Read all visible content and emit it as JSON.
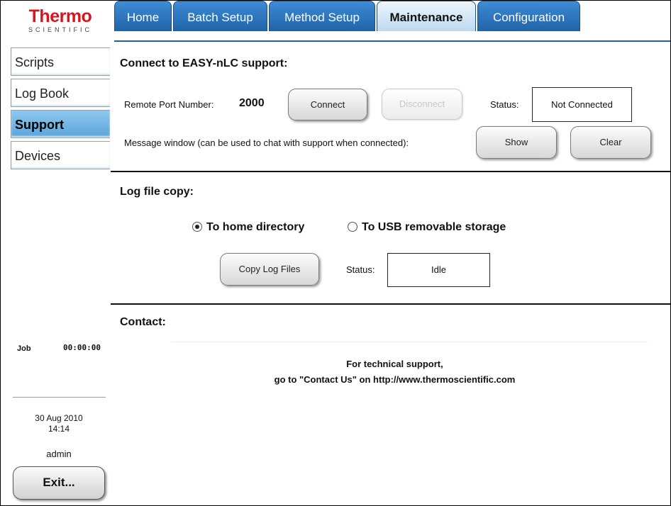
{
  "logo": {
    "brand": "Thermo",
    "sub": "SCIENTIFIC"
  },
  "tabs": [
    {
      "label": "Home"
    },
    {
      "label": "Batch Setup"
    },
    {
      "label": "Method Setup"
    },
    {
      "label": "Maintenance",
      "active": true
    },
    {
      "label": "Configuration"
    }
  ],
  "sidebar": {
    "items": [
      {
        "label": "Scripts"
      },
      {
        "label": "Log Book"
      },
      {
        "label": "Support",
        "active": true
      },
      {
        "label": "Devices"
      }
    ],
    "job_label": "Job",
    "job_time": "00:00:00",
    "date": "30 Aug 2010",
    "time": "14:14",
    "user": "admin",
    "exit_label": "Exit..."
  },
  "support": {
    "title": "Connect to EASY-nLC support:",
    "port_label": "Remote Port Number:",
    "port_value": "2000",
    "connect_label": "Connect",
    "disconnect_label": "Disconnect",
    "status_label": "Status:",
    "status_value": "Not Connected",
    "message_label": "Message window (can be used to chat with support when connected):",
    "show_label": "Show",
    "clear_label": "Clear"
  },
  "logcopy": {
    "title": "Log file copy:",
    "option_home": "To home directory",
    "option_usb": "To USB removable storage",
    "selected": "home",
    "copy_label": "Copy Log Files",
    "status_label": "Status:",
    "status_value": "Idle"
  },
  "contact": {
    "title": "Contact:",
    "line1": "For technical support,",
    "line2": "go to \"Contact Us\" on http://www.thermoscientific.com"
  },
  "colors": {
    "tab_blue": "#1f64a8",
    "tab_active": "#bcd9f0",
    "nav_active": "#5aa5dc",
    "brand_red": "#d6161e"
  }
}
